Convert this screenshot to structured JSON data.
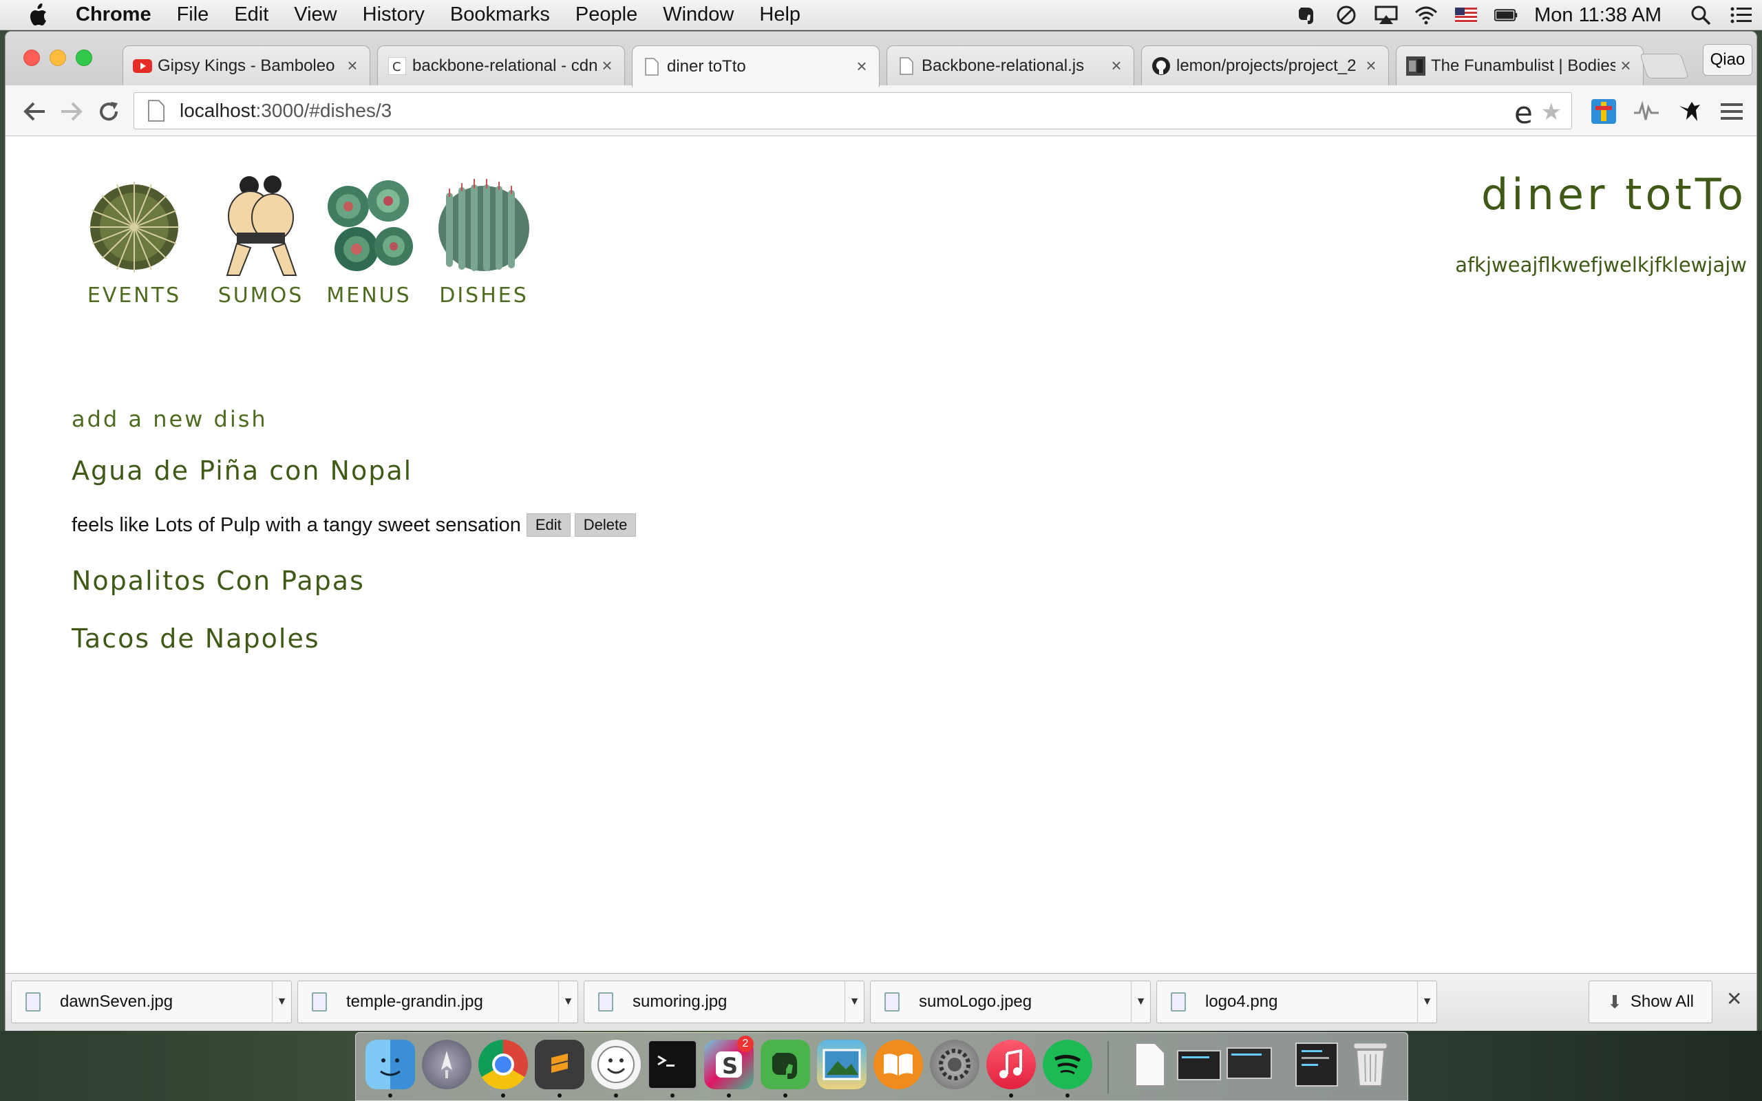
{
  "menubar": {
    "app_name": "Chrome",
    "items": [
      "File",
      "Edit",
      "View",
      "History",
      "Bookmarks",
      "People",
      "Window",
      "Help"
    ],
    "clock": "Mon 11:38 AM",
    "tray_icons": [
      "evernote-icon",
      "sync-icon",
      "airplay-icon",
      "wifi-icon",
      "us-flag-icon",
      "battery-icon",
      "spotlight-icon",
      "notification-center-icon"
    ]
  },
  "browser": {
    "tabs": [
      {
        "title": "Gipsy Kings - Bamboleo",
        "icon": "youtube-icon"
      },
      {
        "title": "backbone-relational - cdnjs",
        "icon": "cdnjs-icon"
      },
      {
        "title": "diner toTto",
        "icon": "page-icon",
        "active": true
      },
      {
        "title": "Backbone-relational.js",
        "icon": "page-icon"
      },
      {
        "title": "lemon/projects/project_2",
        "icon": "github-icon"
      },
      {
        "title": "The Funambulist | Bodies",
        "icon": "funambulist-icon"
      }
    ],
    "profile_name": "Qiao",
    "url_host": "localhost",
    "url_rest": ":3000/#dishes/3"
  },
  "site": {
    "nav": [
      {
        "label": "EVENTS",
        "image": "round-cactus"
      },
      {
        "label": "SUMOS",
        "image": "sumo-wrestlers"
      },
      {
        "label": "MENUS",
        "image": "succulents"
      },
      {
        "label": "DISHES",
        "image": "tall-cactus"
      }
    ],
    "title": "diner totTo",
    "subtitle": "afkjweajflkwefjwelkjfklewjajw",
    "add_link": "add a new dish",
    "dishes": [
      {
        "name": "Agua de Piña con Nopal",
        "description": "feels like Lots of Pulp with a tangy sweet sensation",
        "edit_label": "Edit",
        "delete_label": "Delete"
      },
      {
        "name": "Nopalitos Con Papas"
      },
      {
        "name": "Tacos de Napoles"
      }
    ]
  },
  "downloads": {
    "files": [
      "dawnSeven.jpg",
      "temple-grandin.jpg",
      "sumoring.jpg",
      "sumoLogo.jpeg",
      "logo4.png"
    ],
    "show_all_label": "Show All"
  },
  "dock": {
    "apps": [
      "finder-icon",
      "launchpad-icon",
      "chrome-icon",
      "sublime-text-icon",
      "smiley-app-icon",
      "terminal-icon",
      "slack-icon",
      "evernote-icon",
      "iphoto-icon",
      "ibooks-icon",
      "system-preferences-icon",
      "itunes-icon",
      "spotify-icon"
    ],
    "slack_badge": "2"
  },
  "colors": {
    "site_green": "#3e5a16",
    "button_gray": "#cfcfcf"
  }
}
